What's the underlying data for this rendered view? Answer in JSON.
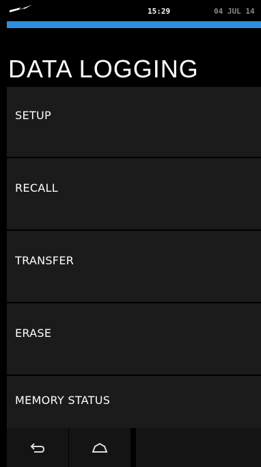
{
  "status_bar": {
    "signal_icon": "lightning-icon",
    "time": "15:29",
    "date": "04 JUL 14"
  },
  "header": {
    "title": "DATA LOGGING"
  },
  "menu": {
    "items": [
      {
        "label": "SETUP"
      },
      {
        "label": "RECALL"
      },
      {
        "label": "TRANSFER"
      },
      {
        "label": "ERASE"
      },
      {
        "label": "MEMORY STATUS"
      }
    ]
  },
  "navbar": {
    "back_icon": "back-arrow-icon",
    "home_icon": "home-icon"
  },
  "colors": {
    "accent": "#2e8fe0",
    "background": "#000000",
    "menu_item": "#1b1b1b"
  }
}
